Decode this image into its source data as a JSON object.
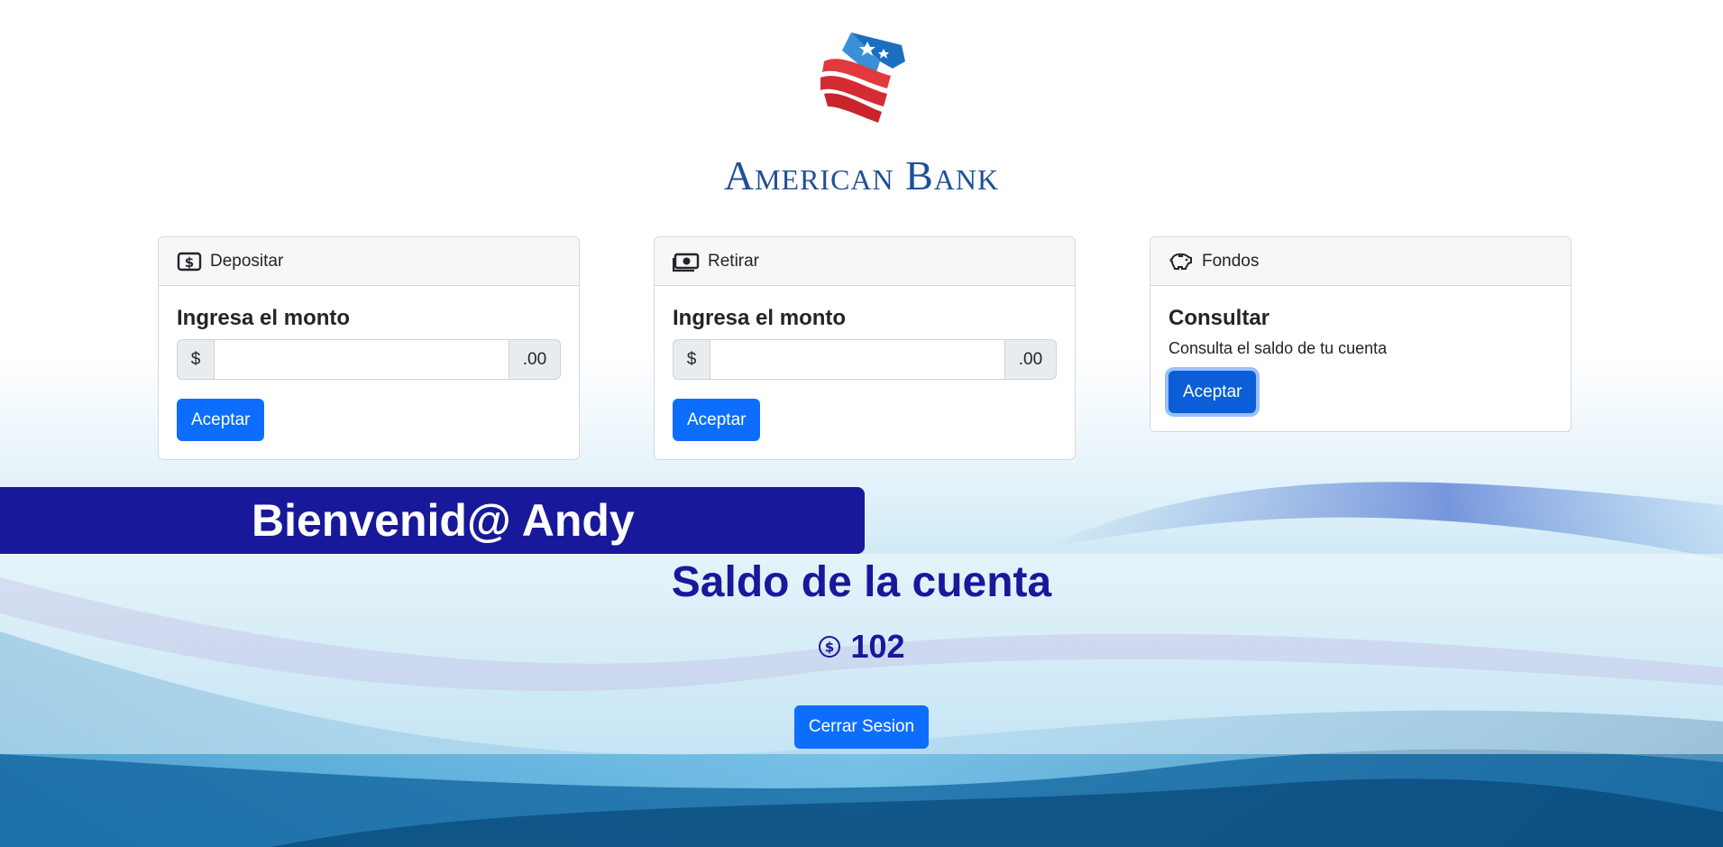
{
  "bank": {
    "name": "American Bank"
  },
  "cards": {
    "deposit": {
      "header": "Depositar",
      "title": "Ingresa el monto",
      "prefix": "$",
      "suffix": ".00",
      "value": "",
      "button": "Aceptar"
    },
    "withdraw": {
      "header": "Retirar",
      "title": "Ingresa el monto",
      "prefix": "$",
      "suffix": ".00",
      "value": "",
      "button": "Aceptar"
    },
    "funds": {
      "header": "Fondos",
      "title": "Consultar",
      "text": "Consulta el saldo de tu cuenta",
      "button": "Aceptar"
    }
  },
  "welcome": {
    "text": "Bienvenid@ Andy"
  },
  "balance": {
    "title": "Saldo de la cuenta",
    "amount": "102"
  },
  "logout": {
    "label": "Cerrar Sesion"
  },
  "colors": {
    "primary": "#0d6efd",
    "welcome_bar": "#18189b",
    "bank_name": "#1f4f98",
    "card_header_bg": "#f7f7f7"
  },
  "icons": {
    "deposit": "cash-dollar-icon",
    "withdraw": "cash-stack-icon",
    "funds": "piggy-bank-icon",
    "balance": "coin-icon"
  }
}
